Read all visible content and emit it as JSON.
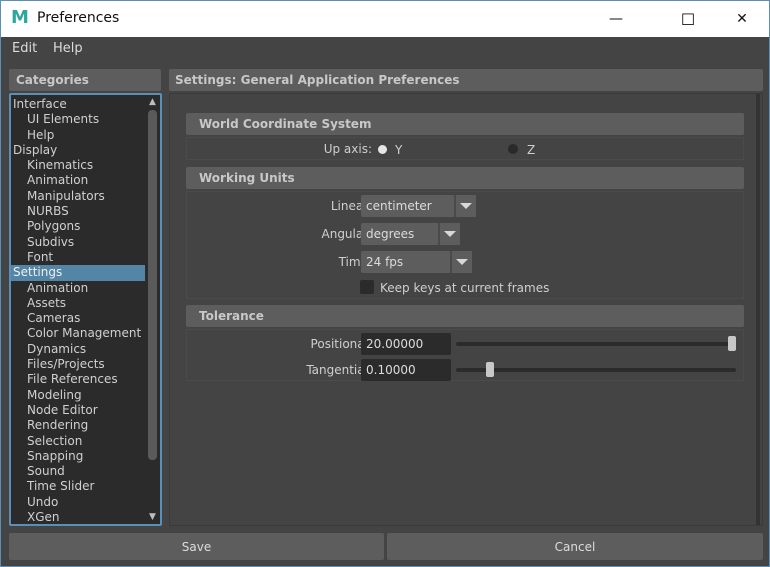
{
  "window": {
    "title": "Preferences",
    "app_icon": "maya-m-icon",
    "controls": {
      "minimize": "—",
      "maximize": "☐",
      "close": "✕"
    }
  },
  "menubar": {
    "items": [
      {
        "label": "Edit"
      },
      {
        "label": "Help"
      }
    ]
  },
  "categories": {
    "header": "Categories",
    "items": [
      {
        "label": "Interface",
        "level": "top"
      },
      {
        "label": "UI Elements",
        "level": "sub"
      },
      {
        "label": "Help",
        "level": "sub"
      },
      {
        "label": "Display",
        "level": "top"
      },
      {
        "label": "Kinematics",
        "level": "sub"
      },
      {
        "label": "Animation",
        "level": "sub"
      },
      {
        "label": "Manipulators",
        "level": "sub"
      },
      {
        "label": "NURBS",
        "level": "sub"
      },
      {
        "label": "Polygons",
        "level": "sub"
      },
      {
        "label": "Subdivs",
        "level": "sub"
      },
      {
        "label": "Font",
        "level": "sub"
      },
      {
        "label": "Settings",
        "level": "top",
        "selected": true
      },
      {
        "label": "Animation",
        "level": "sub"
      },
      {
        "label": "Assets",
        "level": "sub"
      },
      {
        "label": "Cameras",
        "level": "sub"
      },
      {
        "label": "Color Management",
        "level": "sub"
      },
      {
        "label": "Dynamics",
        "level": "sub"
      },
      {
        "label": "Files/Projects",
        "level": "sub"
      },
      {
        "label": "File References",
        "level": "sub"
      },
      {
        "label": "Modeling",
        "level": "sub"
      },
      {
        "label": "Node Editor",
        "level": "sub"
      },
      {
        "label": "Rendering",
        "level": "sub"
      },
      {
        "label": "Selection",
        "level": "sub"
      },
      {
        "label": "Snapping",
        "level": "sub"
      },
      {
        "label": "Sound",
        "level": "sub"
      },
      {
        "label": "Time Slider",
        "level": "sub"
      },
      {
        "label": "Undo",
        "level": "sub"
      },
      {
        "label": "XGen",
        "level": "sub"
      }
    ],
    "scroll_up": "▲",
    "scroll_down": "▼"
  },
  "settings": {
    "header": "Settings: General Application Preferences",
    "world_coordinate": {
      "title": "World Coordinate System",
      "up_axis_label": "Up axis:",
      "options": [
        {
          "label": "Y",
          "selected": true
        },
        {
          "label": "Z",
          "selected": false
        }
      ]
    },
    "working_units": {
      "title": "Working Units",
      "linear_label": "Linear:",
      "linear_value": "centimeter",
      "angular_label": "Angular:",
      "angular_value": "degrees",
      "time_label": "Time:",
      "time_value": "24 fps",
      "keep_keys_label": "Keep keys at current frames",
      "keep_keys_checked": false
    },
    "tolerance": {
      "title": "Tolerance",
      "positional_label": "Positional:",
      "positional_value": "20.00000",
      "positional_slider_fraction": 1.0,
      "tangential_label": "Tangential:",
      "tangential_value": "0.10000",
      "tangential_slider_fraction": 0.11
    }
  },
  "footer": {
    "save_label": "Save",
    "cancel_label": "Cancel"
  },
  "colors": {
    "selection": "#5285a6",
    "window_border": "#5b8fb8",
    "background": "#444444",
    "panel": "#5d5d5d",
    "field": "#2b2b2b"
  }
}
